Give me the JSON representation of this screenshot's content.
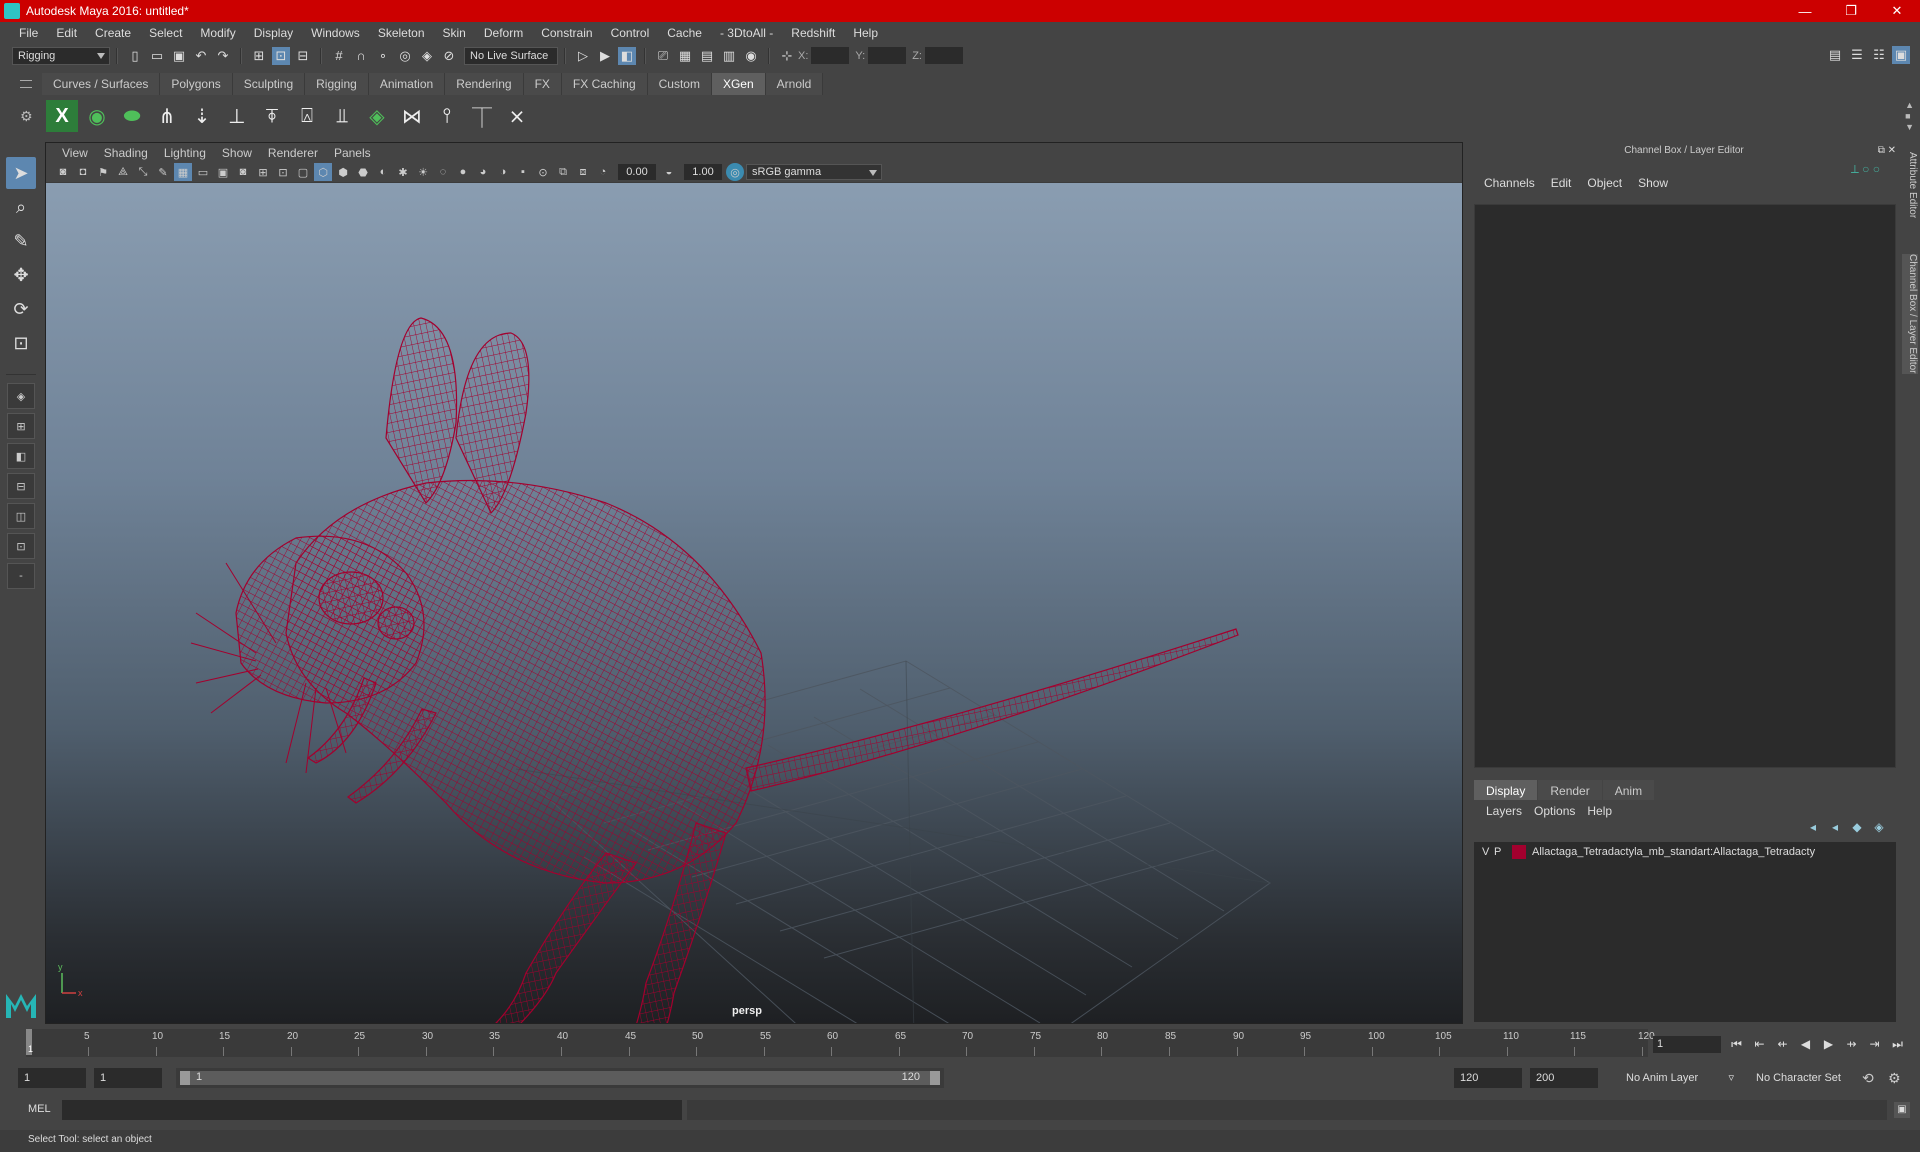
{
  "window": {
    "title": "Autodesk Maya 2016: untitled*",
    "minimize": "—",
    "maximize": "❐",
    "close": "✕"
  },
  "menus": [
    "File",
    "Edit",
    "Create",
    "Select",
    "Modify",
    "Display",
    "Windows",
    "Skeleton",
    "Skin",
    "Deform",
    "Constrain",
    "Control",
    "Cache",
    "- 3DtoAll -",
    "Redshift",
    "Help"
  ],
  "statusline": {
    "mode": "Rigging",
    "live_surface": "No Live Surface",
    "x_label": "X:",
    "y_label": "Y:",
    "z_label": "Z:"
  },
  "shelf": {
    "tabs": [
      "Curves / Surfaces",
      "Polygons",
      "Sculpting",
      "Rigging",
      "Animation",
      "Rendering",
      "FX",
      "FX Caching",
      "Custom",
      "XGen",
      "Arnold"
    ],
    "active_tab": "XGen"
  },
  "viewport": {
    "menus": [
      "View",
      "Shading",
      "Lighting",
      "Show",
      "Renderer",
      "Panels"
    ],
    "exposure": "0.00",
    "gamma": "1.00",
    "color_space": "sRGB gamma",
    "camera_label": "persp",
    "axis_y": "y",
    "axis_x": "x"
  },
  "channel_box": {
    "title": "Channel Box / Layer Editor",
    "menus": [
      "Channels",
      "Edit",
      "Object",
      "Show"
    ]
  },
  "layer_editor": {
    "tabs": [
      "Display",
      "Render",
      "Anim"
    ],
    "menus": [
      "Layers",
      "Options",
      "Help"
    ],
    "layers": [
      {
        "v": "V",
        "p": "P",
        "color": "#a3002e",
        "name": "Allactaga_Tetradactyla_mb_standart:Allactaga_Tetradacty"
      }
    ]
  },
  "side_tabs": [
    "Attribute Editor",
    "Channel Box / Layer Editor"
  ],
  "timeslider": {
    "ticks": [
      "5",
      "10",
      "15",
      "20",
      "25",
      "30",
      "35",
      "40",
      "45",
      "50",
      "55",
      "60",
      "65",
      "70",
      "75",
      "80",
      "85",
      "90",
      "95",
      "100",
      "105",
      "110",
      "115",
      "120"
    ],
    "current_frame_label": "1",
    "current_frame": "1"
  },
  "range": {
    "start": "1",
    "playback_start": "1",
    "bar_start": "1",
    "bar_end": "120",
    "playback_end": "120",
    "end": "200",
    "anim_layer": "No Anim Layer",
    "character_set": "No Character Set"
  },
  "command_line": {
    "label": "MEL"
  },
  "help_line": "Select Tool: select an object",
  "colors": {
    "titlebar": "#cc0000",
    "wireframe": "#a3002e",
    "active_tool": "#5d87b0"
  }
}
